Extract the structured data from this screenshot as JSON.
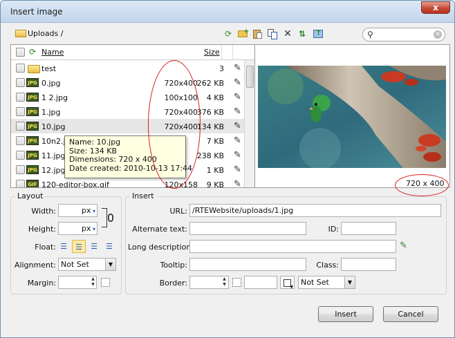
{
  "window": {
    "title": "Insert image",
    "close_label": "x"
  },
  "toolbar": {
    "path": "Uploads /",
    "icons": [
      "refresh-icon",
      "new-folder-icon",
      "paste-icon",
      "copy-icon",
      "delete-icon",
      "sort-icon",
      "upload-icon"
    ],
    "search_placeholder": ""
  },
  "files": {
    "columns": {
      "name": "Name",
      "size": "Size"
    },
    "rows": [
      {
        "name": "test",
        "dims": "",
        "size": "3",
        "type": "folder"
      },
      {
        "name": "0.jpg",
        "dims": "720x400",
        "size": "262 KB",
        "type": "JPG"
      },
      {
        "name": "1 2.jpg",
        "dims": "100x100",
        "size": "4 KB",
        "type": "JPG"
      },
      {
        "name": "1.jpg",
        "dims": "720x400",
        "size": "376 KB",
        "type": "JPG"
      },
      {
        "name": "10.jpg",
        "dims": "720x400",
        "size": "134 KB",
        "type": "JPG"
      },
      {
        "name": "10n2.jpg",
        "dims": "",
        "size": "7 KB",
        "type": "JPG"
      },
      {
        "name": "11.jpg",
        "dims": "",
        "size": "238 KB",
        "type": "JPG"
      },
      {
        "name": "12.jpg",
        "dims": "",
        "size": "1 KB",
        "type": "JPG"
      },
      {
        "name": "120-editor-box.gif",
        "dims": "120x158",
        "size": "9 KB",
        "type": "GIF"
      }
    ]
  },
  "tooltip": {
    "name": "Name: 10.jpg",
    "size": "Size: 134 KB",
    "dimensions": "Dimensions: 720 x 400",
    "date": "Date created: 2010-10-13 17:44"
  },
  "preview": {
    "dimensions": "720 x 400"
  },
  "layout": {
    "legend": "Layout",
    "width_label": "Width:",
    "width_value": "",
    "width_unit": "px",
    "height_label": "Height:",
    "height_value": "",
    "height_unit": "px",
    "float_label": "Float:",
    "alignment_label": "Alignment:",
    "alignment_value": "Not Set",
    "margin_label": "Margin:",
    "margin_value": ""
  },
  "insert": {
    "legend": "Insert",
    "url_label": "URL:",
    "url_value": "/RTEWebsite/uploads/1.jpg",
    "alt_label": "Alternate text:",
    "alt_value": "",
    "id_label": "ID:",
    "id_value": "",
    "longdesc_label": "Long description:",
    "longdesc_value": "",
    "tooltip_label": "Tooltip:",
    "tooltip_value": "",
    "class_label": "Class:",
    "class_value": "",
    "border_label": "Border:",
    "border_value": "",
    "border_style_value": "Not Set"
  },
  "buttons": {
    "insert": "Insert",
    "cancel": "Cancel"
  },
  "colors": {
    "titlebar": "#c3d6ec",
    "highlight_oval": "#d71a1a",
    "tooltip_bg": "#ffffe1",
    "selected_float": "#fde9a8"
  }
}
